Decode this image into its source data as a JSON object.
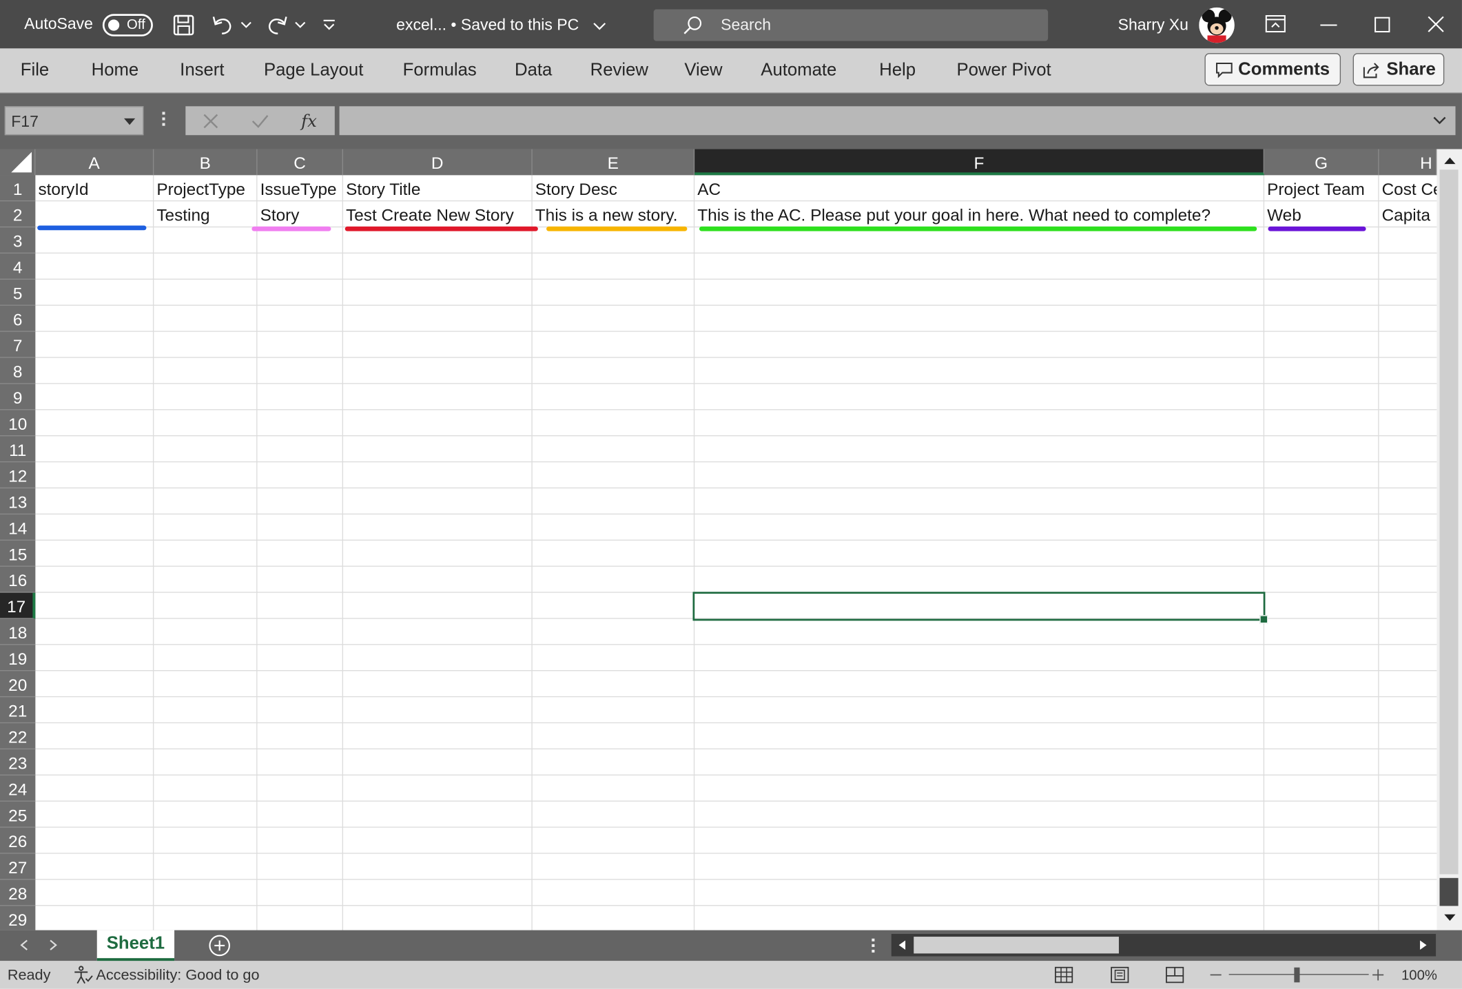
{
  "titlebar": {
    "autosave_label": "AutoSave",
    "autosave_state": "Off",
    "doc_title": "excel...  •  Saved to this PC",
    "search_placeholder": "Search",
    "user_name": "Sharry Xu"
  },
  "menu": {
    "tabs": [
      "File",
      "Home",
      "Insert",
      "Page Layout",
      "Formulas",
      "Data",
      "Review",
      "View",
      "Automate",
      "Help",
      "Power Pivot"
    ],
    "comments_label": "Comments",
    "share_label": "Share"
  },
  "formula_bar": {
    "name_box": "F17",
    "formula_value": ""
  },
  "grid": {
    "columns": [
      "A",
      "B",
      "C",
      "D",
      "E",
      "F",
      "G",
      "H"
    ],
    "selected_column": "F",
    "selected_row": "17",
    "rows": [
      "1",
      "2",
      "3",
      "4",
      "5",
      "6",
      "7",
      "8",
      "9",
      "10",
      "11",
      "12",
      "13",
      "14",
      "15",
      "16",
      "17",
      "18",
      "19",
      "20",
      "21",
      "22",
      "23",
      "24",
      "25",
      "26",
      "27",
      "28",
      "29"
    ],
    "row1": [
      "storyId",
      "ProjectType",
      "IssueType",
      "Story Title",
      "Story Desc",
      "AC",
      "Project Team",
      "Cost Ce"
    ],
    "row2": [
      "",
      "Testing",
      "Story",
      "Test Create New Story",
      "This is a new story.",
      "This is the AC. Please put your goal in here. What need to complete?",
      "Web",
      "Capita"
    ],
    "underline_colors": [
      "#1d5fe0",
      "#f07ef0",
      "#e0182a",
      "#f7b500",
      "#2ee01e",
      "#6a14d8"
    ]
  },
  "sheets": {
    "active": "Sheet1"
  },
  "status": {
    "ready": "Ready",
    "accessibility": "Accessibility: Good to go",
    "zoom": "100%"
  }
}
